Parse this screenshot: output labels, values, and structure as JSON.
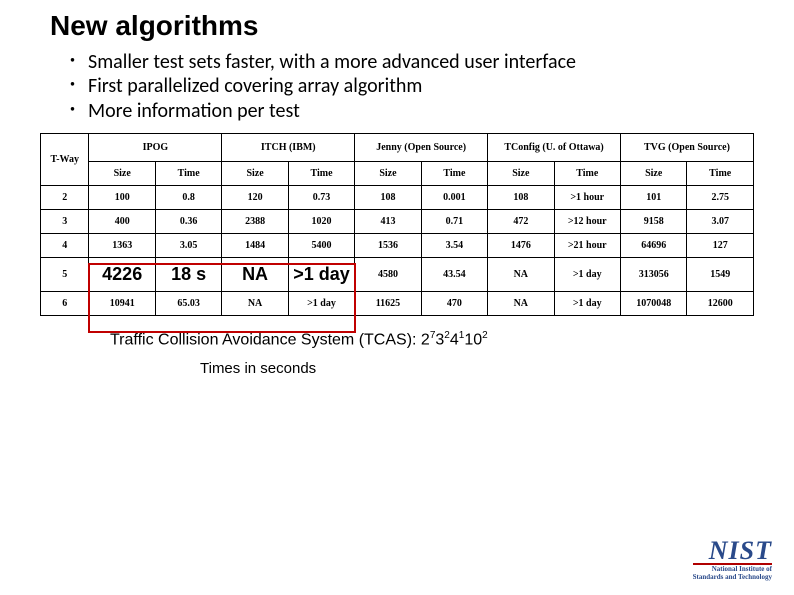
{
  "title": "New algorithms",
  "bullets": [
    "Smaller test sets faster, with a more advanced user interface",
    "First parallelized covering array algorithm",
    "More information per test"
  ],
  "table": {
    "rowHeader": "T-Way",
    "groups": [
      "IPOG",
      "ITCH (IBM)",
      "Jenny (Open Source)",
      "TConfig (U. of Ottawa)",
      "TVG (Open Source)"
    ],
    "subHeaders": [
      "Size",
      "Time"
    ],
    "rows": [
      {
        "t": "2",
        "cells": [
          "100",
          "0.8",
          "120",
          "0.73",
          "108",
          "0.001",
          "108",
          ">1 hour",
          "101",
          "2.75"
        ]
      },
      {
        "t": "3",
        "cells": [
          "400",
          "0.36",
          "2388",
          "1020",
          "413",
          "0.71",
          "472",
          ">12 hour",
          "9158",
          "3.07"
        ]
      },
      {
        "t": "4",
        "cells": [
          "1363",
          "3.05",
          "1484",
          "5400",
          "1536",
          "3.54",
          "1476",
          ">21 hour",
          "64696",
          "127"
        ]
      },
      {
        "t": "5",
        "cells": [
          "4226",
          "18 s",
          "NA",
          ">1 day",
          "4580",
          "43.54",
          "NA",
          ">1 day",
          "313056",
          "1549"
        ]
      },
      {
        "t": "6",
        "cells": [
          "10941",
          "65.03",
          "NA",
          ">1 day",
          "11625",
          "470",
          "NA",
          ">1 day",
          "1070048",
          "12600"
        ]
      }
    ]
  },
  "caption_prefix": "Traffic Collision Avoidance System (TCAS):  2",
  "caption_sup1": "7",
  "caption_mid1": "3",
  "caption_sup2": "2",
  "caption_mid2": "4",
  "caption_sup3": "1",
  "caption_mid3": "10",
  "caption_sup4": "2",
  "subcaption": "Times in seconds",
  "logo": {
    "name": "NIST",
    "line1": "National Institute of",
    "line2": "Standards and Technology"
  }
}
